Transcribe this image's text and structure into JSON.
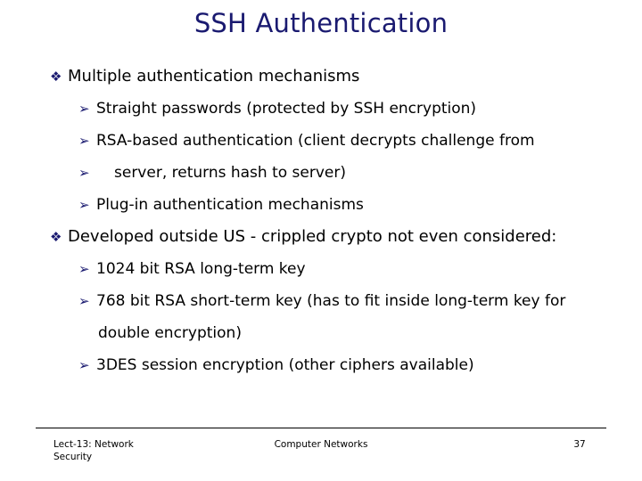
{
  "slide": {
    "title": "SSH Authentication",
    "title_color": "#1a1a70",
    "bullet_color": "#1a1a70",
    "text_color": "#000000",
    "background_color": "#ffffff",
    "bullet_level1_glyph": "❖",
    "bullet_level1_name": "diamond-bullet-icon",
    "bullet_level2_glyph": "➢",
    "bullet_level2_name": "arrow-bullet-icon",
    "lines": [
      {
        "level": 1,
        "bullet": "❖",
        "text": "Multiple authentication mechanisms"
      },
      {
        "level": 2,
        "bullet": "➢",
        "text": "Straight passwords (protected by SSH encryption)"
      },
      {
        "level": 2,
        "bullet": "➢",
        "text": "RSA-based authentication (client decrypts challenge from"
      },
      {
        "level": 2,
        "bullet": "➢",
        "text": "server, returns hash to server)",
        "indent": true
      },
      {
        "level": 2,
        "bullet": "➢",
        "text": "Plug-in authentication mechanisms"
      },
      {
        "level": 1,
        "bullet": "❖",
        "text": "Developed outside US - crippled crypto not even considered:"
      },
      {
        "level": 2,
        "bullet": "➢",
        "text": "1024 bit RSA long-term key"
      },
      {
        "level": 2,
        "bullet": "➢",
        "text": "768 bit RSA short-term key (has to fit inside long-term key for"
      },
      {
        "level": 0,
        "bullet": "",
        "text": "double encryption)"
      },
      {
        "level": 2,
        "bullet": "➢",
        "text": "3DES session encryption (other ciphers available)"
      }
    ]
  },
  "footer": {
    "left_line1": "Lect-13: Network",
    "left_line2": "Security",
    "center": "Computer Networks",
    "page_number": "37"
  }
}
